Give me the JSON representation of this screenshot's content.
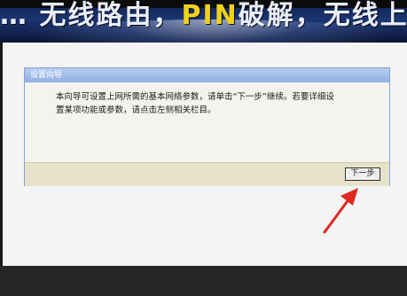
{
  "banner": {
    "part1": "… 无线路由，",
    "accent": "PIN",
    "part2": "破解，无线上网新选择"
  },
  "panel": {
    "title": "设置向导",
    "message_line1": "本向导可设置上网所需的基本网络参数，请单击“下一步”继续。若要详细设",
    "message_line2": "置某项功能或参数，请点击左侧相关栏目。",
    "next_button": "下一步"
  },
  "annotation": {
    "arrow_color": "#e0291f",
    "target": "next-button"
  }
}
